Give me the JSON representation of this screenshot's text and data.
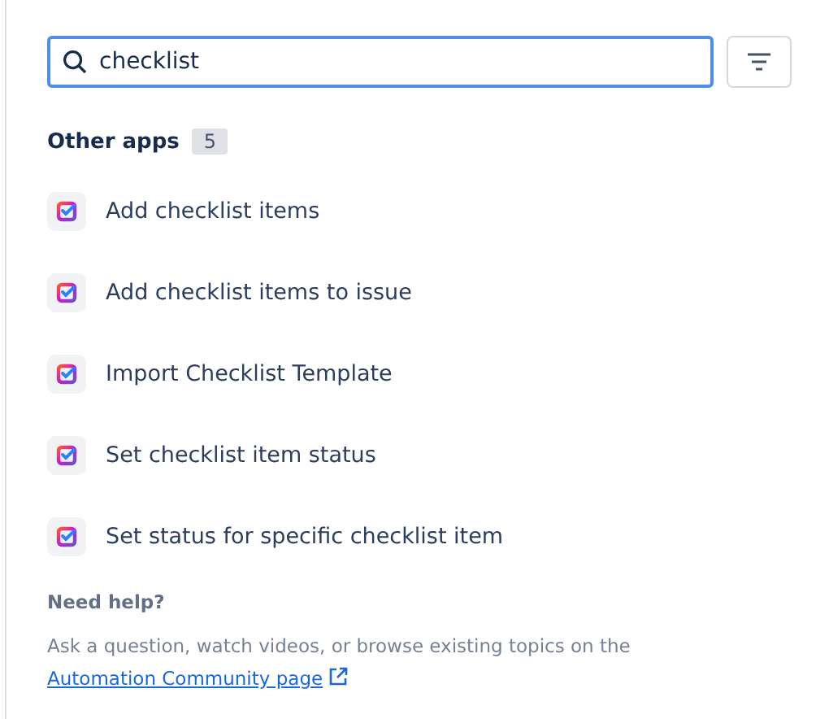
{
  "search": {
    "value": "checklist"
  },
  "section": {
    "title": "Other apps",
    "count": "5"
  },
  "items": [
    {
      "label": "Add checklist items"
    },
    {
      "label": "Add checklist items to issue"
    },
    {
      "label": "Import Checklist Template"
    },
    {
      "label": "Set checklist item status"
    },
    {
      "label": "Set status for specific checklist item"
    }
  ],
  "help": {
    "title": "Need help?",
    "text": "Ask a question, watch videos, or browse existing topics on the",
    "link": "Automation Community page"
  }
}
